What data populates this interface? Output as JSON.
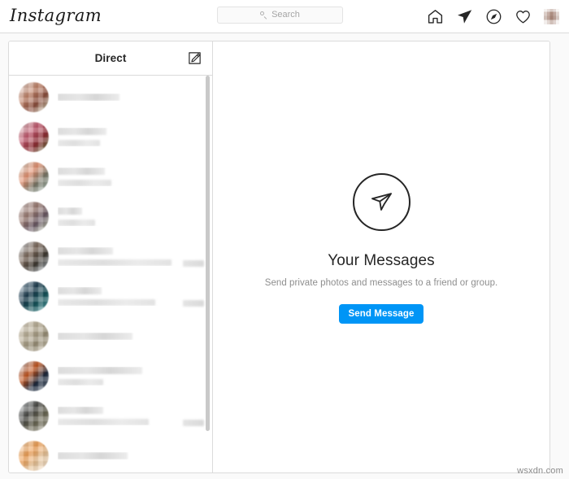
{
  "header": {
    "logo_text": "Instagram",
    "search": {
      "placeholder": "Search",
      "value": "",
      "icon": "search-icon"
    },
    "nav_icons": [
      {
        "name": "home-icon",
        "label": "Home"
      },
      {
        "name": "direct-paper-plane-icon",
        "label": "Direct"
      },
      {
        "name": "explore-compass-icon",
        "label": "Explore"
      },
      {
        "name": "activity-heart-icon",
        "label": "Activity"
      },
      {
        "name": "profile-avatar",
        "label": "Profile"
      }
    ]
  },
  "thread_panel": {
    "title": "Direct",
    "compose_icon": "compose-new-message-icon",
    "scrollbar": {
      "name": "thread-list-scrollbar",
      "position": "top"
    },
    "threads": [
      {
        "avatar_colors": [
          "#efe9e6",
          "#c2846a",
          "#8c4f3e",
          "#dfe9cf"
        ],
        "name_width": 76,
        "preview_width": 0,
        "has_time": false
      },
      {
        "avatar_colors": [
          "#e9e4e0",
          "#c45a70",
          "#8e2f35",
          "#6f8a50"
        ],
        "name_width": 60,
        "preview_width": 52,
        "has_time": false
      },
      {
        "avatar_colors": [
          "#dfe7e2",
          "#e59272",
          "#7b7a6a",
          "#b9cfc6"
        ],
        "name_width": 58,
        "preview_width": 66,
        "has_time": false
      },
      {
        "avatar_colors": [
          "#e6e0df",
          "#9b7b72",
          "#6b5a66",
          "#d9e6c8"
        ],
        "name_width": 30,
        "preview_width": 46,
        "has_time": false
      },
      {
        "avatar_colors": [
          "#dfe6ec",
          "#7d6a5c",
          "#3f3a33",
          "#c3cfd8"
        ],
        "name_width": 68,
        "preview_width": 140,
        "has_time": true
      },
      {
        "avatar_colors": [
          "#cfdce6",
          "#1d3c4e",
          "#17565c",
          "#63b0b4"
        ],
        "name_width": 54,
        "preview_width": 120,
        "has_time": true
      },
      {
        "avatar_colors": [
          "#e8e2d6",
          "#b9ae96",
          "#9a9078",
          "#d8d2c0"
        ],
        "name_width": 92,
        "preview_width": 0,
        "has_time": false
      },
      {
        "avatar_colors": [
          "#cfe0ee",
          "#c5561f",
          "#1d2a3e",
          "#7e8b97"
        ],
        "name_width": 104,
        "preview_width": 56,
        "has_time": false
      },
      {
        "avatar_colors": [
          "#dde2e6",
          "#4a4a46",
          "#6d6a56",
          "#b8b6a8"
        ],
        "name_width": 56,
        "preview_width": 112,
        "has_time": true
      },
      {
        "avatar_colors": [
          "#f5e4cf",
          "#f0a055",
          "#e7c49a",
          "#fbf0e2"
        ],
        "name_width": 86,
        "preview_width": 0,
        "has_time": false
      }
    ]
  },
  "empty_state": {
    "icon": "paper-plane-circle-icon",
    "title": "Your Messages",
    "subtitle": "Send private photos and messages to a friend or group.",
    "button_label": "Send Message",
    "button_color": "#0095f6"
  },
  "watermark": {
    "text": "wsxdn.com"
  }
}
